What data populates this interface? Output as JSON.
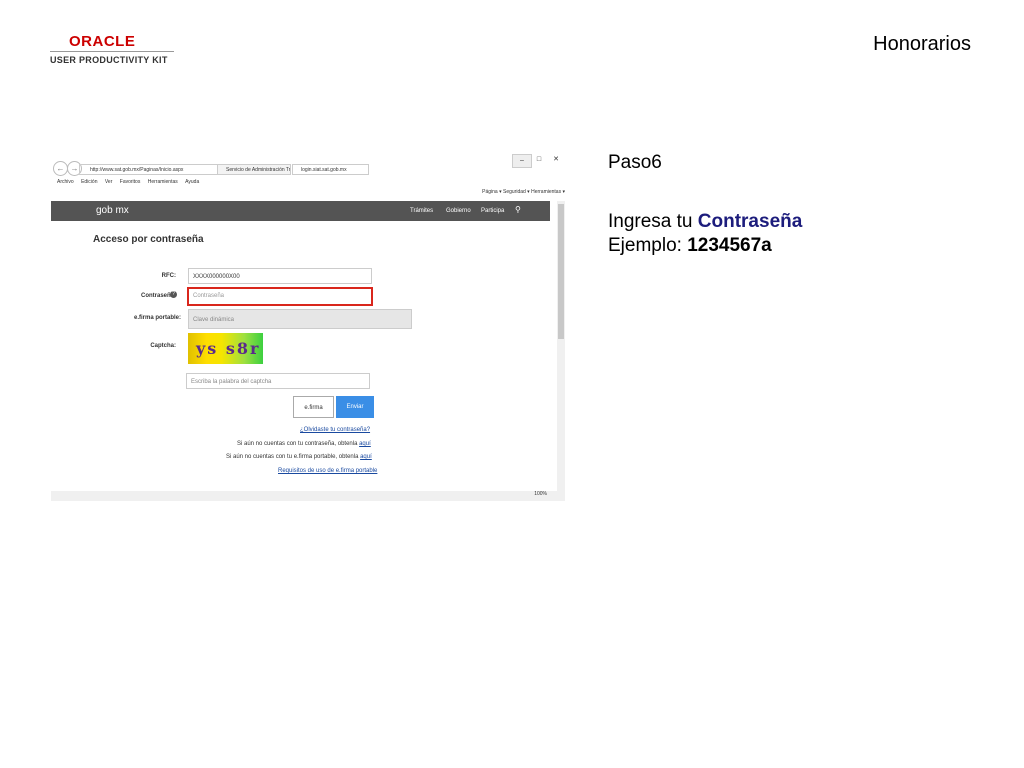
{
  "header": {
    "logo_text": "ORACLE",
    "logo_subtitle": "USER PRODUCTIVITY KIT",
    "title": "Honorarios"
  },
  "panel": {
    "step": "Paso6",
    "instruction_prefix": "Ingresa tu ",
    "instruction_highlight": "Contraseña",
    "example_prefix": "Ejemplo: ",
    "example_value": "1234567a",
    "highlight_color": "#1c1c7c"
  },
  "browser": {
    "address": "http://www.sat.gob.mx/Paginas/Inicio.aspx",
    "tabs": [
      "Servicio de Administración Tri...",
      "login.siat.sat.gob.mx"
    ],
    "menu": [
      "Archivo",
      "Edición",
      "Ver",
      "Favoritos",
      "Herramientas",
      "Ayuda"
    ],
    "command_bar": "Página ▾  Seguridad ▾  Herramientas ▾",
    "zoom": "100%"
  },
  "site": {
    "brand": "gob mx",
    "nav": [
      "Trámites",
      "Gobierno",
      "Participa"
    ],
    "heading": "Acceso por contraseña",
    "rfc_label": "RFC:",
    "rfc_value": "XXXX000000X00",
    "password_label": "Contraseña:",
    "password_placeholder": "Contraseña",
    "efirma_label": "e.firma portable:",
    "efirma_placeholder": "Clave dinámica",
    "captcha_label": "Captcha:",
    "captcha_text": "ys s8r",
    "captcha_input_placeholder": "Escriba la palabra del captcha",
    "efirma_button": "e.firma",
    "submit_button": "Enviar",
    "forgot_link": "¿Olvidaste tu contraseña?",
    "no_password_text": "Si aún no cuentas con tu contraseña, obtenla ",
    "no_efirma_text": "Si aún no cuentas con tu e.firma portable, obtenla ",
    "here_link": "aquí",
    "requirements_link": "Requisitos de uso de e.firma portable"
  },
  "colors": {
    "brand_bar": "#545454",
    "submit": "#3a8ee6",
    "highlight_border": "#d9261c"
  }
}
